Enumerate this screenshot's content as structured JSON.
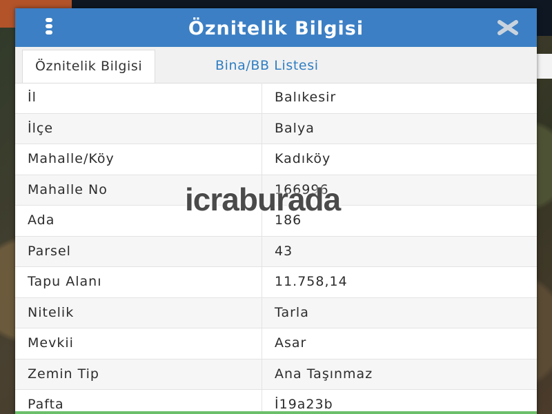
{
  "dialog": {
    "title": "Öznitelik Bilgisi",
    "tabs": [
      {
        "label": "Öznitelik Bilgisi",
        "active": true
      },
      {
        "label": "Bina/BB Listesi",
        "active": false
      }
    ],
    "rows": [
      {
        "key": "İl",
        "value": "Balıkesir"
      },
      {
        "key": "İlçe",
        "value": "Balya"
      },
      {
        "key": "Mahalle/Köy",
        "value": "Kadıköy"
      },
      {
        "key": "Mahalle No",
        "value": "166996"
      },
      {
        "key": "Ada",
        "value": "186"
      },
      {
        "key": "Parsel",
        "value": "43"
      },
      {
        "key": "Tapu Alanı",
        "value": "11.758,14"
      },
      {
        "key": "Nitelik",
        "value": "Tarla"
      },
      {
        "key": "Mevkii",
        "value": "Asar"
      },
      {
        "key": "Zemin Tip",
        "value": "Ana Taşınmaz"
      },
      {
        "key": "Pafta",
        "value": "İ19a23b"
      }
    ]
  },
  "watermark": "icraburada",
  "icons": {
    "menu": "vertical-dots-menu-icon",
    "close": "close-x-icon"
  },
  "colors": {
    "titlebar": "#3c7fc4",
    "tab_link": "#2f7ec2",
    "bottom_accent": "#6cbf6a"
  }
}
